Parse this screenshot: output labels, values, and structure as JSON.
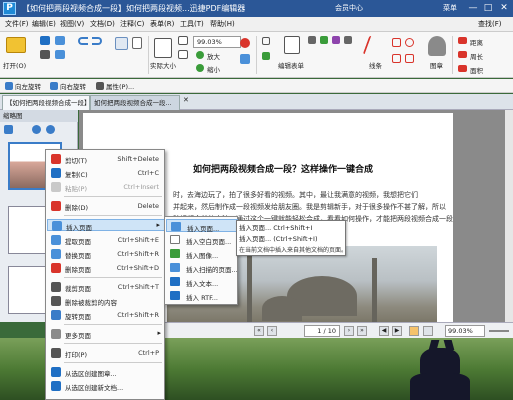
{
  "titlebar": {
    "app_icon": "P",
    "title": "【如何把两段视频合成一段】如何把两段视频...迅捷PDF编辑器",
    "member": "会员中心",
    "menu": "菜单",
    "min": "—",
    "max": "□",
    "close": "✕"
  },
  "menubar": {
    "items": [
      "文件(F)",
      "编辑(E)",
      "视图(V)",
      "文档(D)",
      "注释(C)",
      "表单(R)",
      "工具(T)",
      "帮助(H)"
    ],
    "find": "查找(F)",
    "search": "搜索(S)"
  },
  "ribbon": {
    "open": "打开(O)",
    "actual_size": "实际大小",
    "zoom": "99.03%",
    "zoom_in": "放大",
    "zoom_out": "缩小",
    "edit_form": "编辑表单",
    "line": "线条",
    "stamp": "图章",
    "distance": "距离",
    "perimeter": "周长",
    "area": "面积"
  },
  "toolbar2": {
    "rotate_left": "向左旋转",
    "rotate_right": "向右旋转",
    "properties": "属性(P)..."
  },
  "tabs": [
    "【如何把两段视频合成一段】",
    "如何把两段视频合成一段..."
  ],
  "thumbpanel": {
    "title": "缩略图"
  },
  "document": {
    "title": "如何把两段视频合成一段？这样操作一键合成",
    "lines": [
      "时，去海边玩了，拍了很多好看的视频。其中，最让我满意的视频，我想把它们",
      "并起来，然后制作成一段视频发给朋友圈。我是剪辑新手，对于很多操作不甚了解，所以",
      "种视频合并的方法，通过这个一键就能轻松合成，看看如何操作，才能把两段视频合成一段"
    ]
  },
  "statusbar": {
    "page": "1 / 10",
    "zoom": "99.03%"
  },
  "context_menu": {
    "items": [
      {
        "label": "剪切(T)",
        "shortcut": "Shift+Delete",
        "disabled": false
      },
      {
        "label": "复制(C)",
        "shortcut": "Ctrl+C",
        "disabled": false
      },
      {
        "label": "粘贴(P)",
        "shortcut": "Ctrl+Insert",
        "disabled": true
      },
      {
        "label": "删除(D)",
        "shortcut": "Delete",
        "disabled": false
      },
      {
        "label": "插入页面",
        "shortcut": "",
        "disabled": false,
        "submenu": true
      },
      {
        "label": "提取页面",
        "shortcut": "Ctrl+Shift+E",
        "disabled": false
      },
      {
        "label": "替换页面",
        "shortcut": "Ctrl+Shift+R",
        "disabled": false
      },
      {
        "label": "删除页面",
        "shortcut": "Ctrl+Shift+D",
        "disabled": false
      },
      {
        "label": "裁剪页面",
        "shortcut": "Ctrl+Shift+T",
        "disabled": false
      },
      {
        "label": "删除被裁剪的内容",
        "shortcut": "",
        "disabled": false
      },
      {
        "label": "旋转页面",
        "shortcut": "Ctrl+Shift+R",
        "disabled": false
      },
      {
        "label": "更多页面",
        "shortcut": "",
        "disabled": false,
        "submenu": true
      },
      {
        "label": "打印(P)",
        "shortcut": "Ctrl+P",
        "disabled": false
      },
      {
        "label": "从选区创建图章...",
        "shortcut": "",
        "disabled": false
      },
      {
        "label": "从选区创建新文档...",
        "shortcut": "",
        "disabled": false
      }
    ]
  },
  "submenu": {
    "items": [
      "插入页面...",
      "插入空白页面...",
      "插入图像...",
      "插入扫描的页面...",
      "插入文本...",
      "插入 RTF..."
    ]
  },
  "tooltip": {
    "line1": "插入页面...    Ctrl+Shift+I",
    "line2": "插入页面... (Ctrl+Shift+I)",
    "line3": "在当前文档中插入来自其他文档的页面。"
  },
  "colors": {
    "titlebar": "#2b5797",
    "highlight": "#cfe4f7",
    "accent_red": "#d9342b",
    "accent_blue": "#1f6fc4"
  }
}
